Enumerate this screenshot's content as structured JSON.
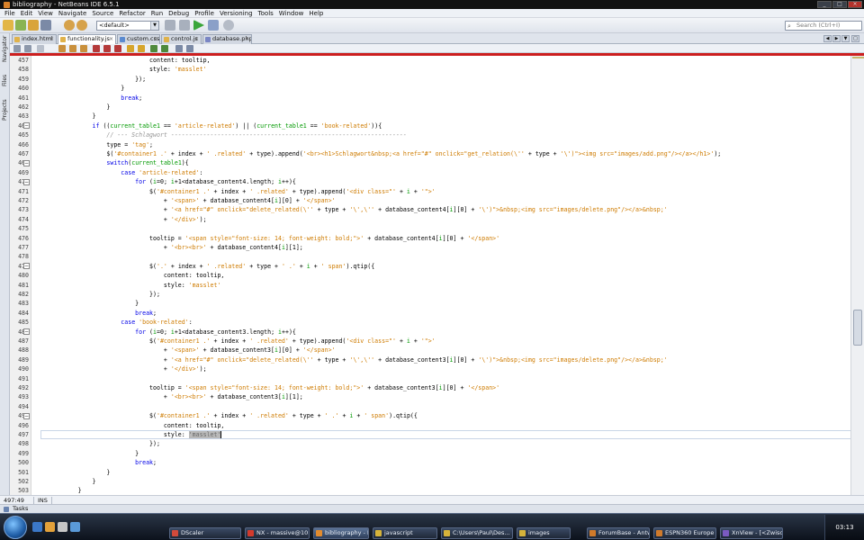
{
  "window": {
    "title": "bibliography - NetBeans IDE 6.5.1"
  },
  "menu": [
    "File",
    "Edit",
    "View",
    "Navigate",
    "Source",
    "Refactor",
    "Run",
    "Debug",
    "Profile",
    "Versioning",
    "Tools",
    "Window",
    "Help"
  ],
  "toolbar": {
    "config_value": "<default>",
    "search_placeholder": "Search (Ctrl+I)"
  },
  "side_tabs": [
    "Navigator",
    "Files",
    "Projects"
  ],
  "tabs": [
    {
      "label": "index.html"
    },
    {
      "label": "functionality.js"
    },
    {
      "label": "custom.css"
    },
    {
      "label": "control.js"
    },
    {
      "label": "database.php"
    }
  ],
  "editor": {
    "lines": [
      {
        "n": "457",
        "code": "                                content: tooltip,"
      },
      {
        "n": "458",
        "code": "                                style: 'masslet'"
      },
      {
        "n": "459",
        "code": "                            });"
      },
      {
        "n": "460",
        "code": "                        }"
      },
      {
        "n": "461",
        "code": "                        break;"
      },
      {
        "n": "462",
        "code": "                    }"
      },
      {
        "n": "463",
        "code": "                }"
      },
      {
        "n": "464",
        "code": "                if ((current_table1 == 'article-related') || (current_table1 == 'book-related')){"
      },
      {
        "n": "465",
        "code": "                    // --- Schlagwort ------------------------------------------------------------------"
      },
      {
        "n": "466",
        "code": "                    type = 'tag';"
      },
      {
        "n": "467",
        "code": "                    $('#container1 .' + index + ' .related' + type).append('<br><h1>Schlagwort&nbsp;<a href=\"#\" onclick=\"get_relation(\\'' + type + '\\')\"><img src=\"images/add.png\"/></a></h1>');"
      },
      {
        "n": "468",
        "code": "                    switch(current_table1){"
      },
      {
        "n": "469",
        "code": "                        case 'article-related':"
      },
      {
        "n": "470",
        "code": "                            for (i=0; i+1<database_content4.length; i++){"
      },
      {
        "n": "471",
        "code": "                                $('#container1 .' + index + ' .related' + type).append('<div class=\"' + i + '\">'"
      },
      {
        "n": "472",
        "code": "                                    + '<span>' + database_content4[i][0] + '</span>'"
      },
      {
        "n": "473",
        "code": "                                    + '<a href=\"#\" onclick=\"delete_related(\\'' + type + '\\',\\'' + database_content4[i][0] + '\\')\">&nbsp;<img src=\"images/delete.png\"/></a>&nbsp;'"
      },
      {
        "n": "474",
        "code": "                                    + '</div>');"
      },
      {
        "n": "475",
        "code": ""
      },
      {
        "n": "476",
        "code": "                                tooltip = '<span style=\"font-size: 14; font-weight: bold;\">' + database_content4[i][0] + '</span>'"
      },
      {
        "n": "477",
        "code": "                                    + '<br><br>' + database_content4[i][1];"
      },
      {
        "n": "478",
        "code": ""
      },
      {
        "n": "479",
        "code": "                                $('.' + index + ' .related' + type + ' .' + i + ' span').qtip({"
      },
      {
        "n": "480",
        "code": "                                    content: tooltip,"
      },
      {
        "n": "481",
        "code": "                                    style: 'masslet'"
      },
      {
        "n": "482",
        "code": "                                });"
      },
      {
        "n": "483",
        "code": "                            }"
      },
      {
        "n": "484",
        "code": "                            break;"
      },
      {
        "n": "485",
        "code": "                        case 'book-related':"
      },
      {
        "n": "486",
        "code": "                            for (i=0; i+1<database_content3.length; i++){"
      },
      {
        "n": "487",
        "code": "                                $('#container1 .' + index + ' .related' + type).append('<div class=\"' + i + '\">'"
      },
      {
        "n": "488",
        "code": "                                    + '<span>' + database_content3[i][0] + '</span>'"
      },
      {
        "n": "489",
        "code": "                                    + '<a href=\"#\" onclick=\"delete_related(\\'' + type + '\\',\\'' + database_content3[i][0] + '\\')\">&nbsp;<img src=\"images/delete.png\"/></a>&nbsp;'"
      },
      {
        "n": "490",
        "code": "                                    + '</div>');"
      },
      {
        "n": "491",
        "code": ""
      },
      {
        "n": "492",
        "code": "                                tooltip = '<span style=\"font-size: 14; font-weight: bold;\">' + database_content3[i][0] + '</span>'"
      },
      {
        "n": "493",
        "code": "                                    + '<br><br>' + database_content3[i][1];"
      },
      {
        "n": "494",
        "code": ""
      },
      {
        "n": "495",
        "code": "                                $('#container1 .' + index + ' .related' + type + ' .' + i + ' span').qtip({"
      },
      {
        "n": "496",
        "code": "                                    content: tooltip,"
      },
      {
        "n": "497",
        "code": "                                    style: 'masslet'"
      },
      {
        "n": "498",
        "code": "                                });"
      },
      {
        "n": "499",
        "code": "                            }"
      },
      {
        "n": "500",
        "code": "                            break;"
      },
      {
        "n": "501",
        "code": "                    }"
      },
      {
        "n": "502",
        "code": "                }"
      },
      {
        "n": "503",
        "code": "            }"
      }
    ]
  },
  "status": {
    "position": "497:49",
    "mode": "INS"
  },
  "tasks_label": "Tasks",
  "taskbar": {
    "buttons": [
      {
        "label": "DScaler",
        "color": "#d24a3b"
      },
      {
        "label": "NX - massive@10....",
        "color": "#d33a2c"
      },
      {
        "label": "bibliography - Net...",
        "color": "#e38b2d"
      },
      {
        "label": "javascript",
        "color": "#d6b33a"
      },
      {
        "label": "C:\\Users\\Paul\\Des...",
        "color": "#d6b33a"
      },
      {
        "label": "images",
        "color": "#d6b33a"
      },
      {
        "label": "ForumBase - Antw...",
        "color": "#d07a2a"
      },
      {
        "label": "ESPN360 Europe Pl...",
        "color": "#d07a2a"
      },
      {
        "label": "XnView - [<Zwisch...",
        "color": "#7a5ac0"
      }
    ],
    "clock": "03:13"
  }
}
